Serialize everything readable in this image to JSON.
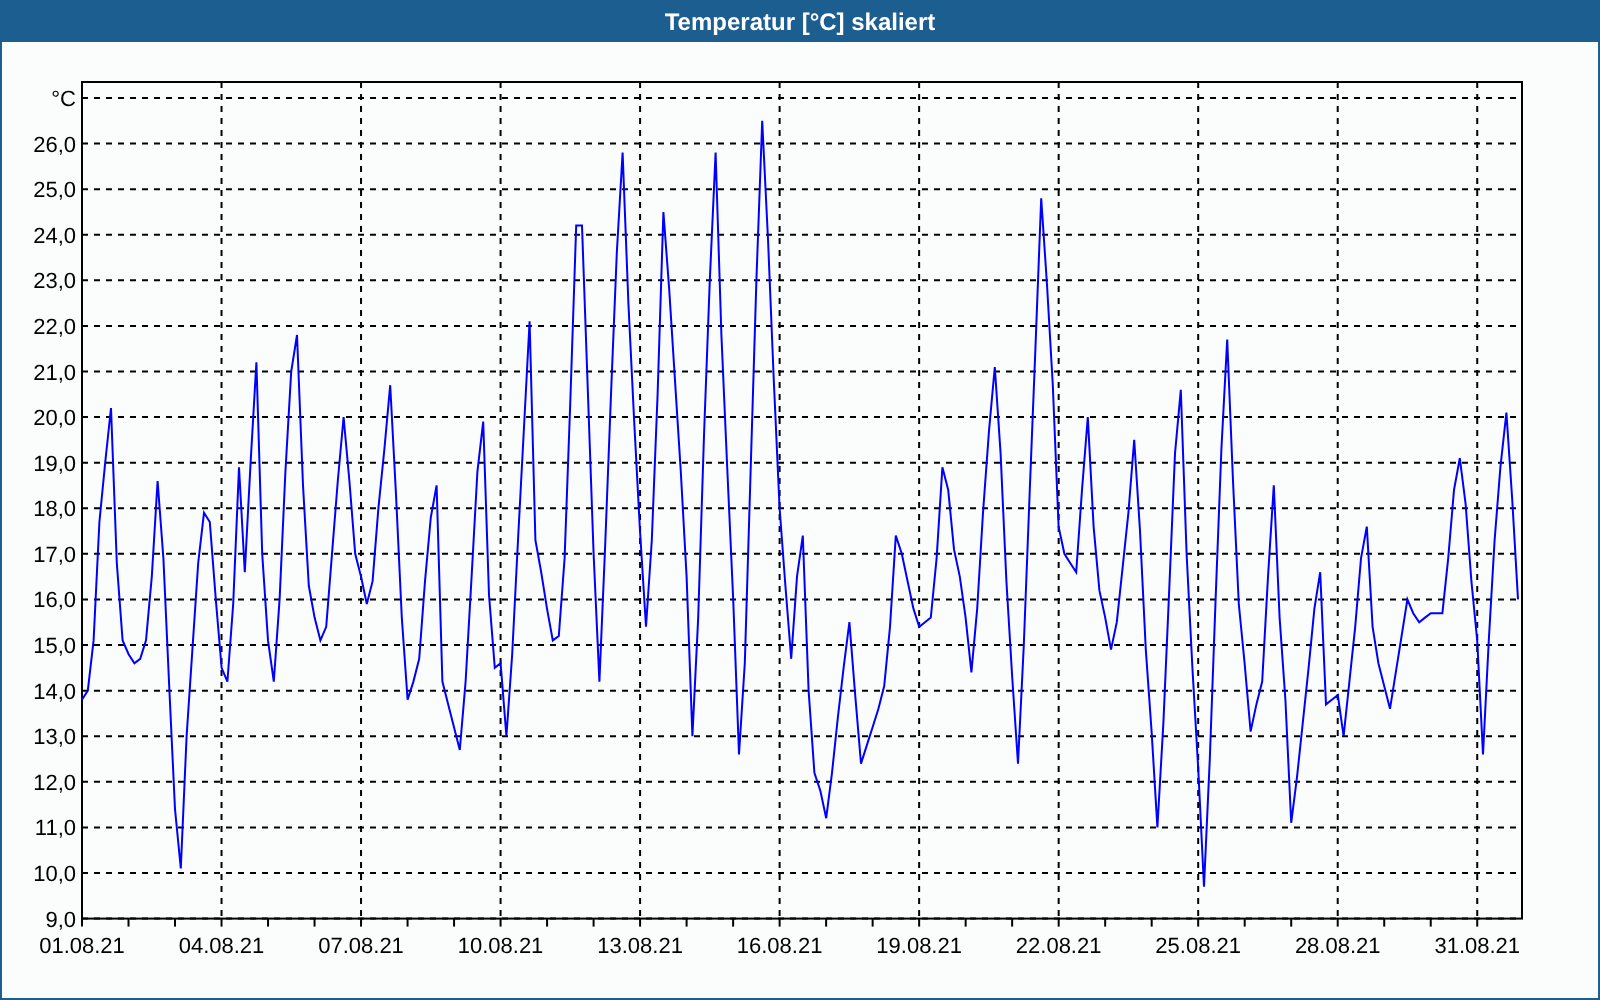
{
  "window": {
    "title": "Temperatur [°C] skaliert"
  },
  "chart": {
    "chart_data": {
      "type": "line",
      "grid": true,
      "ylim": [
        9,
        27.35
      ],
      "yticks": [
        {
          "value": 9,
          "label": "9,0"
        },
        {
          "value": 10,
          "label": "10,0"
        },
        {
          "value": 11,
          "label": "11,0"
        },
        {
          "value": 12,
          "label": "12,0"
        },
        {
          "value": 13,
          "label": "13,0"
        },
        {
          "value": 14,
          "label": "14,0"
        },
        {
          "value": 15,
          "label": "15,0"
        },
        {
          "value": 16,
          "label": "16,0"
        },
        {
          "value": 17,
          "label": "17,0"
        },
        {
          "value": 18,
          "label": "18,0"
        },
        {
          "value": 19,
          "label": "19,0"
        },
        {
          "value": 20,
          "label": "20,0"
        },
        {
          "value": 21,
          "label": "21,0"
        },
        {
          "value": 22,
          "label": "22,0"
        },
        {
          "value": 23,
          "label": "23,0"
        },
        {
          "value": 24,
          "label": "24,0"
        },
        {
          "value": 25,
          "label": "25,0"
        },
        {
          "value": 26,
          "label": "26,0"
        },
        {
          "value": 27,
          "label": "°C"
        }
      ],
      "categories": [
        "01.08.21",
        null,
        null,
        null,
        null,
        null,
        null,
        null,
        null,
        null,
        null,
        null,
        null,
        null,
        null,
        null,
        null,
        null,
        null,
        null,
        null,
        null,
        null,
        null,
        "04.08.21",
        null,
        null,
        null,
        null,
        null,
        null,
        null,
        null,
        null,
        null,
        null,
        null,
        null,
        null,
        null,
        null,
        null,
        null,
        null,
        null,
        null,
        null,
        null,
        "07.08.21",
        null,
        null,
        null,
        null,
        null,
        null,
        null,
        null,
        null,
        null,
        null,
        null,
        null,
        null,
        null,
        null,
        null,
        null,
        null,
        null,
        null,
        null,
        null,
        "10.08.21",
        null,
        null,
        null,
        null,
        null,
        null,
        null,
        null,
        null,
        null,
        null,
        null,
        null,
        null,
        null,
        null,
        null,
        null,
        null,
        null,
        null,
        null,
        null,
        "13.08.21",
        null,
        null,
        null,
        null,
        null,
        null,
        null,
        null,
        null,
        null,
        null,
        null,
        null,
        null,
        null,
        null,
        null,
        null,
        null,
        null,
        null,
        null,
        null,
        "16.08.21",
        null,
        null,
        null,
        null,
        null,
        null,
        null,
        null,
        null,
        null,
        null,
        null,
        null,
        null,
        null,
        null,
        null,
        null,
        null,
        null,
        null,
        null,
        null,
        "19.08.21",
        null,
        null,
        null,
        null,
        null,
        null,
        null,
        null,
        null,
        null,
        null,
        null,
        null,
        null,
        null,
        null,
        null,
        null,
        null,
        null,
        null,
        null,
        null,
        "22.08.21",
        null,
        null,
        null,
        null,
        null,
        null,
        null,
        null,
        null,
        null,
        null,
        null,
        null,
        null,
        null,
        null,
        null,
        null,
        null,
        null,
        null,
        null,
        null,
        "25.08.21",
        null,
        null,
        null,
        null,
        null,
        null,
        null,
        null,
        null,
        null,
        null,
        null,
        null,
        null,
        null,
        null,
        null,
        null,
        null,
        null,
        null,
        null,
        null,
        "28.08.21",
        null,
        null,
        null,
        null,
        null,
        null,
        null,
        null,
        null,
        null,
        null,
        null,
        null,
        null,
        null,
        null,
        null,
        null,
        null,
        null,
        null,
        null,
        null,
        "31.08.21",
        null,
        null,
        null,
        null,
        null,
        null,
        null
      ],
      "series": [
        {
          "color": "#0000ff",
          "values": [
            13.8,
            14.0,
            15.1,
            17.7,
            19.0,
            20.2,
            16.8,
            15.1,
            14.8,
            14.6,
            14.7,
            15.1,
            16.5,
            18.6,
            16.9,
            14.1,
            11.4,
            10.1,
            13.0,
            14.9,
            16.8,
            17.9,
            17.7,
            16.0,
            14.5,
            14.2,
            15.9,
            18.9,
            16.6,
            19.0,
            21.2,
            17.0,
            15.1,
            14.2,
            16.0,
            18.8,
            21.0,
            21.8,
            18.5,
            16.3,
            15.6,
            15.1,
            15.4,
            17.0,
            18.6,
            20.0,
            18.6,
            17.0,
            16.5,
            15.9,
            16.4,
            18.0,
            19.3,
            20.7,
            18.3,
            15.6,
            13.8,
            14.2,
            14.7,
            16.4,
            17.8,
            18.5,
            14.2,
            13.7,
            13.2,
            12.7,
            14.2,
            16.5,
            18.8,
            19.9,
            16.1,
            14.5,
            14.6,
            13.0,
            14.8,
            17.3,
            19.7,
            22.1,
            17.3,
            16.6,
            15.8,
            15.1,
            15.2,
            16.9,
            20.4,
            24.2,
            24.2,
            20.6,
            17.0,
            14.2,
            17.2,
            20.5,
            23.6,
            25.8,
            22.5,
            19.9,
            17.5,
            15.4,
            17.3,
            20.5,
            24.5,
            22.8,
            20.8,
            18.8,
            16.5,
            13.0,
            15.6,
            19.6,
            23.0,
            25.8,
            21.8,
            18.9,
            16.0,
            12.6,
            14.6,
            18.8,
            23.0,
            26.5,
            23.9,
            20.8,
            18.0,
            16.3,
            14.7,
            16.5,
            17.4,
            14.0,
            12.2,
            11.8,
            11.2,
            12.2,
            13.4,
            14.5,
            15.5,
            13.9,
            12.4,
            12.8,
            13.2,
            13.6,
            14.1,
            15.4,
            17.4,
            17.0,
            16.4,
            15.8,
            15.4,
            15.5,
            15.6,
            16.9,
            18.9,
            18.4,
            17.1,
            16.5,
            15.6,
            14.4,
            15.8,
            17.9,
            19.7,
            21.1,
            19.2,
            16.4,
            14.3,
            12.4,
            15.0,
            18.3,
            21.5,
            24.8,
            22.9,
            20.7,
            17.6,
            17.0,
            16.8,
            16.6,
            18.4,
            20.0,
            17.6,
            16.2,
            15.6,
            14.9,
            15.5,
            16.7,
            17.9,
            19.5,
            17.5,
            14.9,
            13.1,
            11.0,
            13.3,
            16.2,
            19.2,
            20.6,
            17.0,
            14.5,
            12.3,
            9.7,
            12.5,
            16.0,
            19.3,
            21.7,
            18.6,
            15.9,
            14.6,
            13.1,
            13.7,
            14.2,
            16.5,
            18.5,
            15.6,
            13.8,
            11.1,
            12.1,
            13.3,
            14.5,
            15.8,
            16.6,
            13.7,
            13.8,
            13.9,
            13.0,
            14.2,
            15.4,
            16.9,
            17.6,
            15.4,
            14.6,
            14.1,
            13.6,
            14.4,
            15.2,
            16.0,
            15.7,
            15.5,
            15.6,
            15.7,
            15.7,
            15.7,
            16.9,
            18.4,
            19.1,
            18.1,
            16.4,
            15.1,
            12.6,
            15.1,
            17.3,
            18.9,
            20.1,
            18.2,
            16.0
          ]
        }
      ]
    }
  }
}
